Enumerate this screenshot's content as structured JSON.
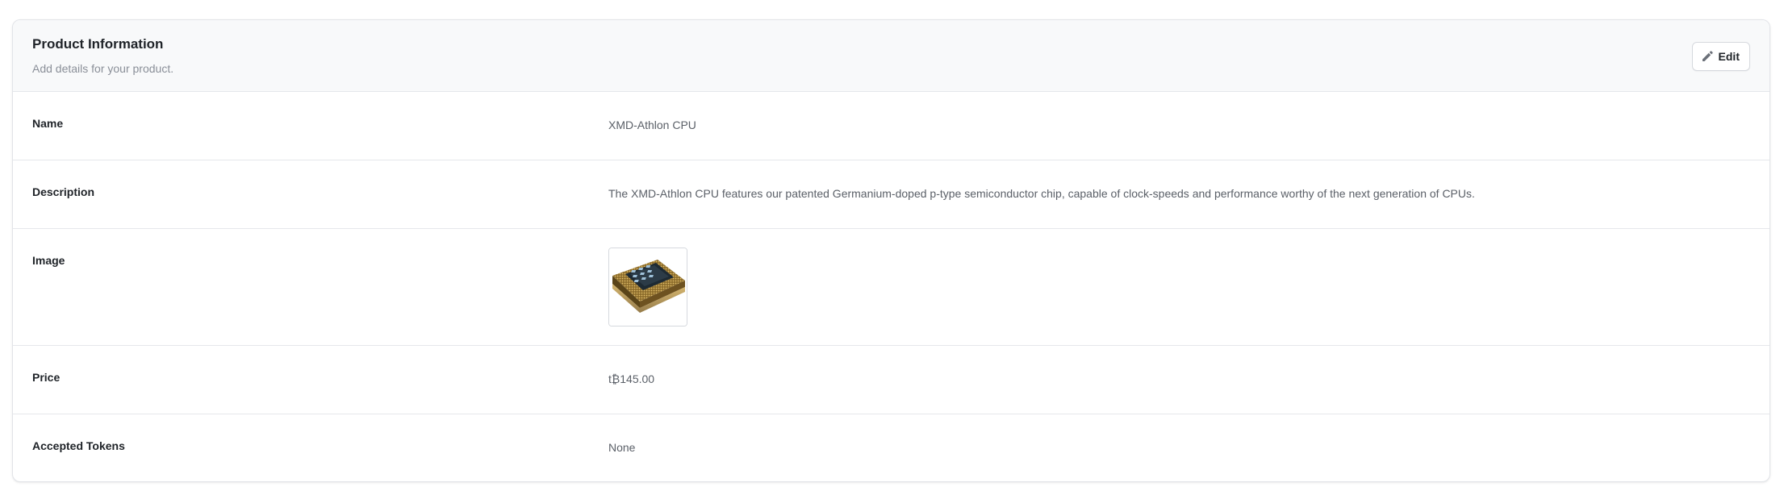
{
  "header": {
    "title": "Product Information",
    "subtitle": "Add details for your product.",
    "edit_label": "Edit"
  },
  "fields": {
    "name": {
      "label": "Name",
      "value": "XMD-Athlon CPU"
    },
    "description": {
      "label": "Description",
      "value": "The XMD-Athlon CPU features our patented Germanium-doped p-type semiconductor chip, capable of clock-speeds and performance worthy of the next generation of CPUs."
    },
    "image": {
      "label": "Image"
    },
    "price": {
      "label": "Price",
      "value": "t₿145.00"
    },
    "accepted_tokens": {
      "label": "Accepted Tokens",
      "value": "None"
    }
  },
  "icons": {
    "edit": "pencil-icon",
    "image": "cpu-chip-image"
  },
  "colors": {
    "header_bg": "#f8f9fa",
    "border": "#e5e7eb",
    "label_text": "#1f2328",
    "value_text": "#5b6068"
  }
}
